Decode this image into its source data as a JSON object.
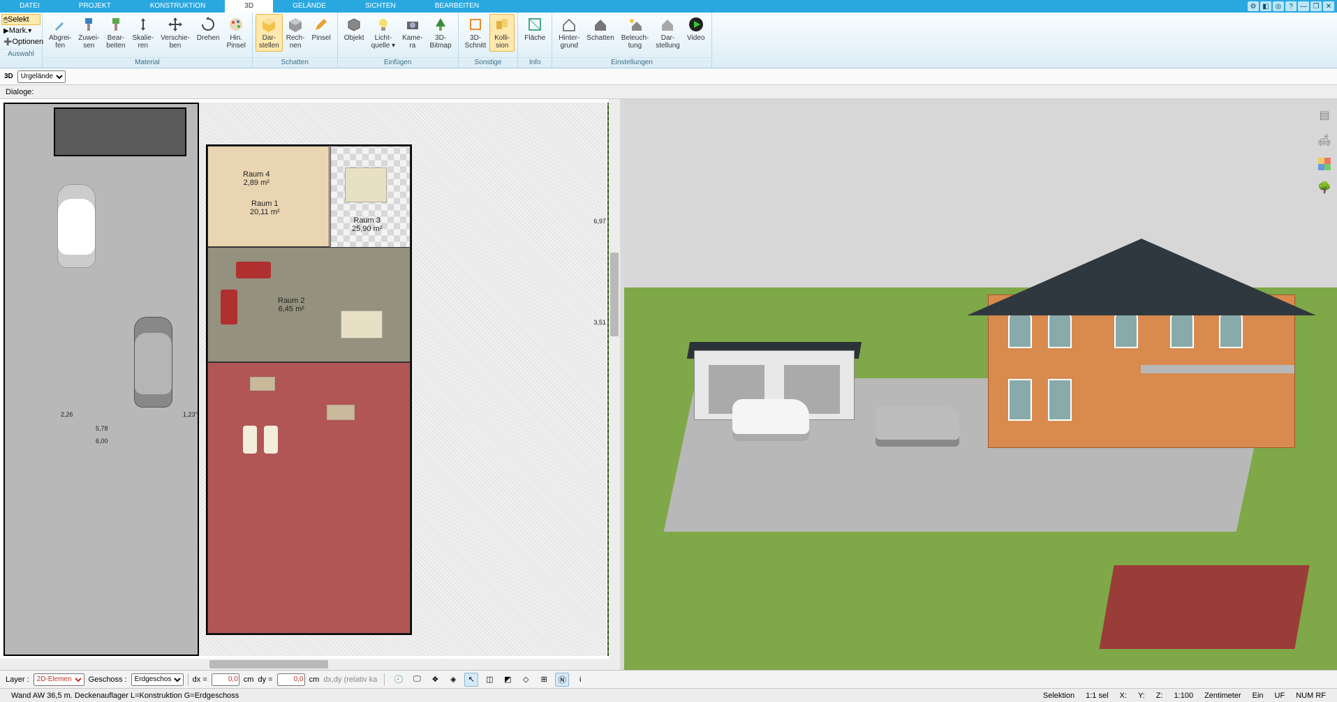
{
  "menu_tabs": [
    "DATEI",
    "PROJEKT",
    "KONSTRUKTION",
    "3D",
    "GELÄNDE",
    "SICHTEN",
    "BEARBEITEN"
  ],
  "menu_active": "3D",
  "window_icons": [
    "gear",
    "cube",
    "target",
    "help",
    "minimize",
    "restore",
    "close"
  ],
  "side_panel": {
    "selekt": "Selekt",
    "mark": "Mark.",
    "optionen": "Optionen",
    "group": "Auswahl"
  },
  "groups": [
    {
      "name": "Material",
      "buttons": [
        {
          "key": "abgreifen",
          "label": "Abgrei-\nfen",
          "icon": "dropper"
        },
        {
          "key": "zuweisen",
          "label": "Zuwei-\nsen",
          "icon": "brush-blue"
        },
        {
          "key": "bearbeiten",
          "label": "Bear-\nbeiten",
          "icon": "brush-green"
        },
        {
          "key": "skalieren",
          "label": "Skalie-\nren",
          "icon": "arrows"
        },
        {
          "key": "verschieben",
          "label": "Verschie-\nben",
          "icon": "move"
        },
        {
          "key": "drehen",
          "label": "Drehen",
          "icon": "rotate"
        },
        {
          "key": "hinpinsel",
          "label": "Hin.\nPinsel",
          "icon": "palette"
        }
      ]
    },
    {
      "name": "Schatten",
      "buttons": [
        {
          "key": "darstellen",
          "label": "Dar-\nstellen",
          "icon": "cube-yellow",
          "active": true
        },
        {
          "key": "rechnen",
          "label": "Rech-\nnen",
          "icon": "cube-grey"
        },
        {
          "key": "pinsel",
          "label": "Pinsel",
          "icon": "pencil"
        }
      ]
    },
    {
      "name": "Einfügen",
      "buttons": [
        {
          "key": "objekt",
          "label": "Objekt",
          "icon": "cube-grey2"
        },
        {
          "key": "lichtquelle",
          "label": "Licht-\nquelle ▾",
          "icon": "bulb"
        },
        {
          "key": "kamera",
          "label": "Kame-\nra",
          "icon": "camera"
        },
        {
          "key": "3dbitmap",
          "label": "3D-\nBitmap",
          "icon": "tree"
        }
      ]
    },
    {
      "name": "Sonstige",
      "buttons": [
        {
          "key": "3dschnitt",
          "label": "3D-\nSchnitt",
          "icon": "cut-orange"
        },
        {
          "key": "kollision",
          "label": "Kolli-\nsion",
          "icon": "collide",
          "active": true
        }
      ]
    },
    {
      "name": "Info",
      "buttons": [
        {
          "key": "flaeche",
          "label": "Fläche",
          "icon": "area"
        }
      ]
    },
    {
      "name": "Einstellungen",
      "buttons": [
        {
          "key": "hintergrund",
          "label": "Hinter-\ngrund",
          "icon": "house-line"
        },
        {
          "key": "schatten2",
          "label": "Schatten",
          "icon": "house-fill"
        },
        {
          "key": "beleuchtung",
          "label": "Beleuch-\ntung",
          "icon": "house-sun"
        },
        {
          "key": "darstellung",
          "label": "Dar-\nstellung",
          "icon": "house-grey"
        },
        {
          "key": "video",
          "label": "Video",
          "icon": "play"
        }
      ]
    }
  ],
  "subbar": {
    "label": "3D",
    "select": "Urgelände"
  },
  "dialog_label": "Dialoge:",
  "rooms": {
    "r1": {
      "name": "Raum 1",
      "area": "20,11 m²"
    },
    "r2": {
      "name": "Raum 2",
      "area": "6,45 m²"
    },
    "r3": {
      "name": "Raum 3",
      "area": "25,90 m²"
    },
    "r4": {
      "name": "Raum 4",
      "area": "2,89 m²"
    }
  },
  "dimensions": {
    "d1": "2,26",
    "d2": "5,78",
    "d3": "6,00",
    "d4": "1,23°",
    "d5": "6,97",
    "d6": "3,51"
  },
  "bottom": {
    "layer_label": "Layer :",
    "layer_value": "2D-Elemen",
    "geschoss_label": "Geschoss :",
    "geschoss_value": "Erdgeschos",
    "dx_label": "dx =",
    "dx_value": "0,0",
    "dx_unit": "cm",
    "dy_label": "dy =",
    "dy_value": "0,0",
    "dy_unit": "cm",
    "hint": "dx,dy (relativ ka"
  },
  "right_tools": [
    "layers",
    "armchair",
    "grid",
    "tree"
  ],
  "status": {
    "left": "Wand AW 36,5 m. Deckenauflager L=Konstruktion G=Erdgeschoss",
    "selektion": "Selektion",
    "ratio": "1:1 sel",
    "x": "X:",
    "y": "Y:",
    "z": "Z:",
    "scale": "1:100",
    "unit": "Zentimeter",
    "ein": "Ein",
    "uf": "UF",
    "num": "NUM RF"
  }
}
